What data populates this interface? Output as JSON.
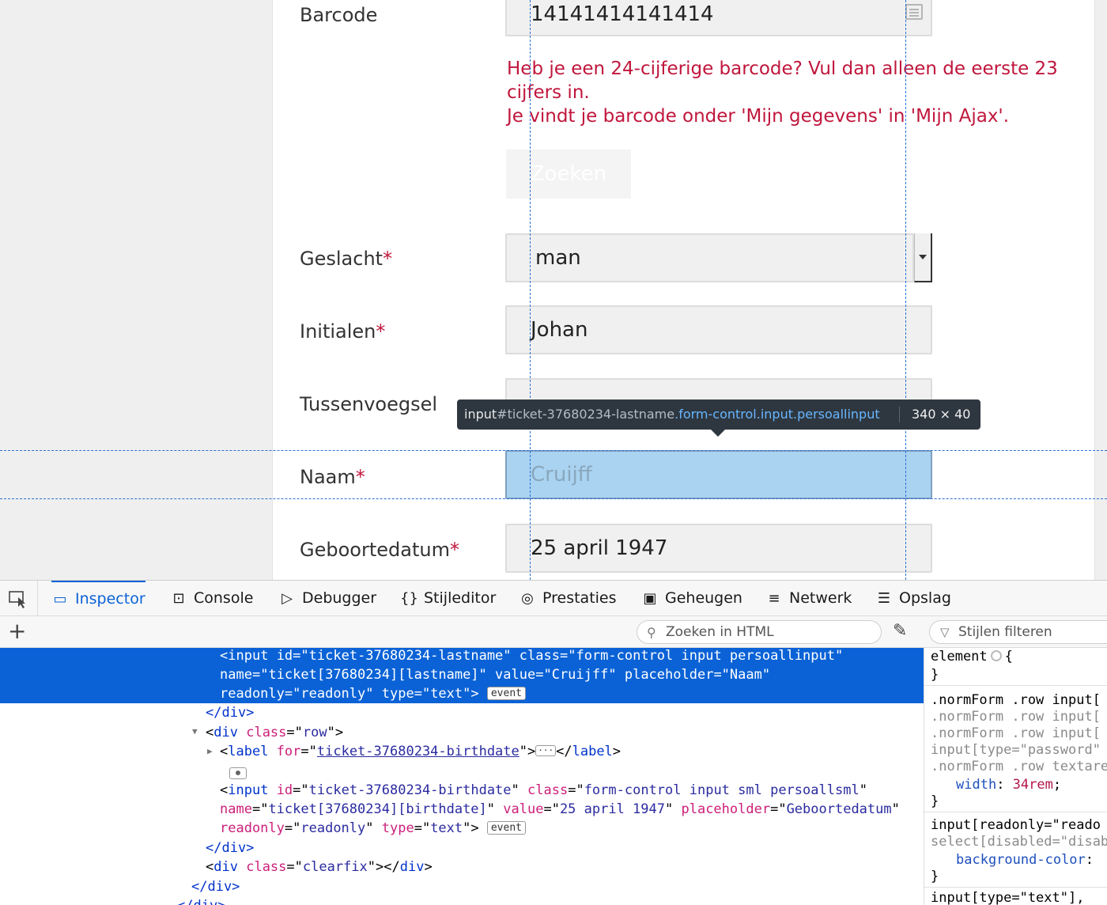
{
  "form": {
    "barcode": {
      "label": "Barcode",
      "value": "14141414141414"
    },
    "barcode_help": {
      "line1": "Heb je een 24-cijferige barcode? Vul dan alleen de eerste 23 cijfers in.",
      "line2": "Je vindt je barcode onder 'Mijn gegevens' in 'Mijn Ajax'."
    },
    "search_button": "Zoeken",
    "gender": {
      "label": "Geslacht",
      "required_mark": "*",
      "value": "man"
    },
    "initials": {
      "label": "Initialen",
      "required_mark": "*",
      "value": "Johan"
    },
    "infix": {
      "label": "Tussenvoegsel"
    },
    "lastname": {
      "label": "Naam",
      "required_mark": "*",
      "value": "Cruijff"
    },
    "birthdate": {
      "label": "Geboortedatum",
      "required_mark": "*",
      "value": "25 april 1947"
    }
  },
  "highlighter": {
    "tag": "input",
    "id_part": "#ticket-37680234-lastname",
    "class_part": ".form-control.input.persoallinput",
    "dimensions": "340 × 40"
  },
  "devtools": {
    "tabs": [
      {
        "label": "Inspector",
        "icon": "inspector-icon",
        "active": true
      },
      {
        "label": "Console",
        "icon": "console-icon"
      },
      {
        "label": "Debugger",
        "icon": "debugger-icon"
      },
      {
        "label": "Stijleditor",
        "icon": "style-editor-icon"
      },
      {
        "label": "Prestaties",
        "icon": "performance-icon"
      },
      {
        "label": "Geheugen",
        "icon": "memory-icon"
      },
      {
        "label": "Netwerk",
        "icon": "network-icon"
      },
      {
        "label": "Opslag",
        "icon": "storage-icon"
      }
    ],
    "html_search_placeholder": "Zoeken in HTML",
    "style_filter_placeholder": "Stijlen filteren",
    "markup": {
      "selected": {
        "tag": "input",
        "id": "ticket-37680234-lastname",
        "class": "form-control input persoallinput",
        "name": "ticket[37680234][lastname]",
        "value": "Cruijff",
        "placeholder": "Naam",
        "readonly": "readonly",
        "type": "text",
        "badge": "event"
      },
      "close_div": "</div>",
      "row_open": {
        "tag": "div",
        "class": "row"
      },
      "label": {
        "for": "ticket-37680234-birthdate"
      },
      "birth_input": {
        "tag": "input",
        "id": "ticket-37680234-birthdate",
        "class": "form-control input sml persoallsml",
        "name": "ticket[37680234][birthdate]",
        "value": "25 april 1947",
        "placeholder": "Geboortedatum",
        "readonly": "readonly",
        "type": "text",
        "badge": "event"
      },
      "clearfix": "clearfix"
    },
    "rules": {
      "element": "element",
      "norm_selectors": [
        ".normForm .row input[",
        ".normForm .row input[",
        ".normForm .row input[",
        "input[type=\"password\"",
        ".normForm .row textare"
      ],
      "width_prop": "width",
      "width_val": "34rem",
      "readonly_selector": "input[readonly=\"reado",
      "select_selector": "select[disabled=\"disab",
      "bg_prop": "background-color",
      "last_selector": "input[type=\"text\"],"
    }
  }
}
